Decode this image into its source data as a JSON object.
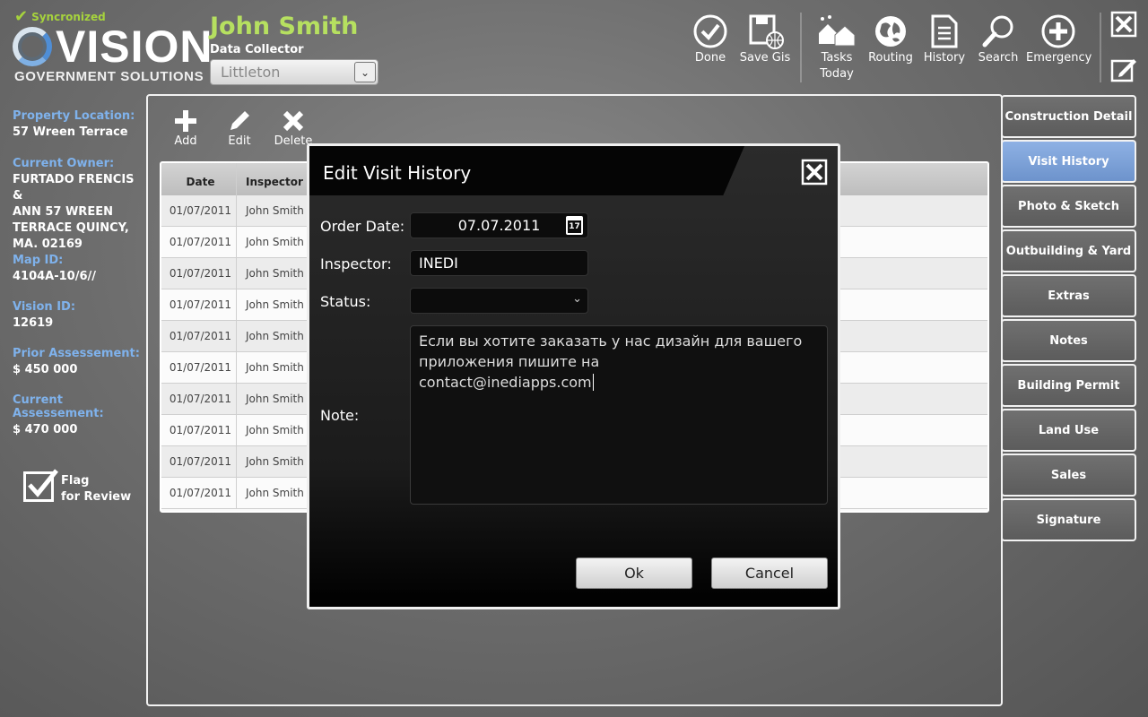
{
  "header": {
    "sync_status": "Syncronized",
    "logo_main": "VISION",
    "logo_sub": "GOVERNMENT SOLUTIONS",
    "user_name": "John Smith",
    "user_role": "Data Collector",
    "town": "Littleton"
  },
  "toolbar": {
    "done": "Done",
    "save_gis": "Save Gis",
    "tasks_today_1": "Tasks",
    "tasks_today_2": "Today",
    "routing": "Routing",
    "history": "History",
    "search": "Search",
    "emergency": "Emergency"
  },
  "property": {
    "location_label": "Property Location:",
    "location": "57 Wreen Terrace",
    "owner_label": "Current Owner:",
    "owner_lines": [
      "FURTADO FRENCIS &",
      "ANN 57 WREEN",
      "TERRACE QUINCY,",
      "MA. 02169"
    ],
    "map_id_label": "Map ID:",
    "map_id": "4104A-10/6//",
    "vision_id_label": "Vision ID:",
    "vision_id": "12619",
    "prior_label": "Prior Assessement:",
    "prior": "$ 450 000",
    "current_label": "Current Assessement:",
    "current": "$ 470 000",
    "flag_line1": "Flag",
    "flag_line2": "for Review",
    "flag_checked": true
  },
  "panel_toolbar": {
    "add": "Add",
    "edit": "Edit",
    "delete": "Delete"
  },
  "table": {
    "columns": [
      "Date",
      "Inspector"
    ],
    "rows": [
      [
        "01/07/2011",
        "John Smith"
      ],
      [
        "01/07/2011",
        "John Smith"
      ],
      [
        "01/07/2011",
        "John Smith"
      ],
      [
        "01/07/2011",
        "John Smith"
      ],
      [
        "01/07/2011",
        "John Smith"
      ],
      [
        "01/07/2011",
        "John Smith"
      ],
      [
        "01/07/2011",
        "John Smith"
      ],
      [
        "01/07/2011",
        "John Smith"
      ],
      [
        "01/07/2011",
        "John Smith"
      ],
      [
        "01/07/2011",
        "John Smith"
      ]
    ]
  },
  "tabs": [
    {
      "label": "Construction Detail",
      "active": false
    },
    {
      "label": "Visit History",
      "active": true
    },
    {
      "label": "Photo & Sketch",
      "active": false
    },
    {
      "label": "Outbuilding & Yard",
      "active": false
    },
    {
      "label": "Extras",
      "active": false
    },
    {
      "label": "Notes",
      "active": false
    },
    {
      "label": "Building Permit",
      "active": false
    },
    {
      "label": "Land Use",
      "active": false
    },
    {
      "label": "Sales",
      "active": false
    },
    {
      "label": "Signature",
      "active": false
    }
  ],
  "dialog": {
    "title": "Edit Visit History",
    "order_date_label": "Order Date:",
    "order_date": "07.07.2011",
    "calendar_day": "17",
    "inspector_label": "Inspector:",
    "inspector": "INEDI",
    "status_label": "Status:",
    "status": "",
    "note_label": "Note:",
    "note_lines": [
      "Если вы хотите заказать у нас дизайн для вашего",
      "приложения пишите на",
      "contact@inediapps.com"
    ],
    "ok": "Ok",
    "cancel": "Cancel"
  },
  "colors": {
    "accent_green": "#b6e060",
    "label_blue": "#7fb2ec",
    "active_tab": "#7fa2d8"
  }
}
